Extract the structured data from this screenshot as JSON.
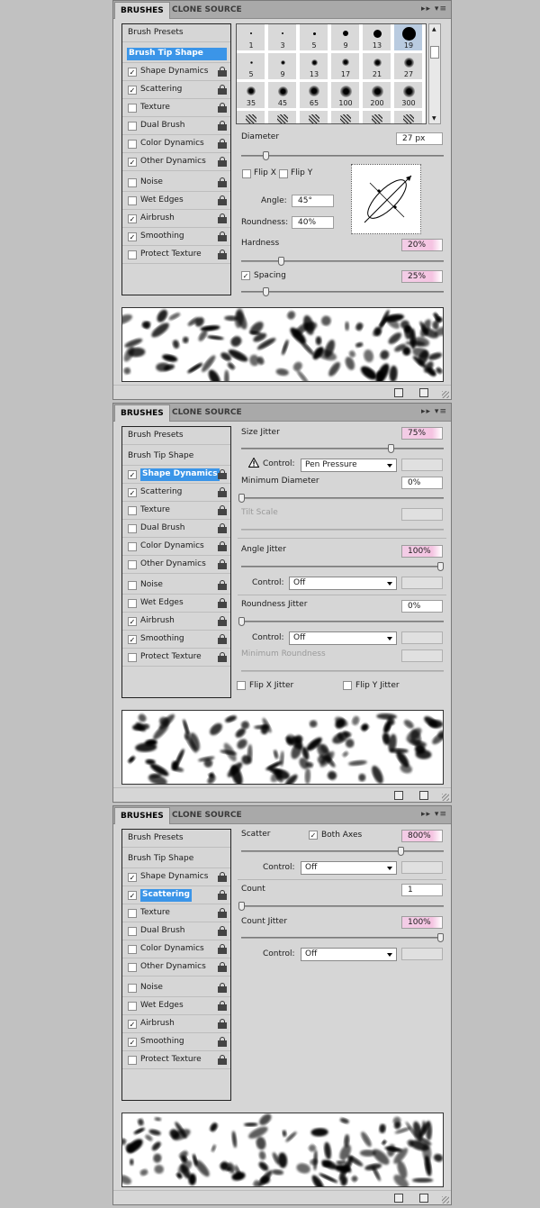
{
  "tabs": {
    "brushes": "BRUSHES",
    "clone_source": "CLONE SOURCE",
    "menu_glyph": "▸▸ ▾≡"
  },
  "list": {
    "brush_presets": "Brush Presets",
    "brush_tip_shape": "Brush Tip Shape",
    "shape_dynamics": "Shape Dynamics",
    "scattering": "Scattering",
    "texture": "Texture",
    "dual_brush": "Dual Brush",
    "color_dynamics": "Color Dynamics",
    "other_dynamics": "Other Dynamics",
    "noise": "Noise",
    "wet_edges": "Wet Edges",
    "airbrush": "Airbrush",
    "smoothing": "Smoothing",
    "protect_texture": "Protect Texture",
    "check": "✓"
  },
  "tip": {
    "sizes": [
      "1",
      "3",
      "5",
      "9",
      "13",
      "19",
      "5",
      "9",
      "13",
      "17",
      "21",
      "27",
      "35",
      "45",
      "65",
      "100",
      "200",
      "300"
    ],
    "diameter_label": "Diameter",
    "diameter_value": "27 px",
    "flip_x": "Flip X",
    "flip_y": "Flip Y",
    "angle_label": "Angle:",
    "angle_value": "45°",
    "roundness_label": "Roundness:",
    "roundness_value": "40%",
    "hardness_label": "Hardness",
    "hardness_value": "20%",
    "spacing_label": "Spacing",
    "spacing_value": "25%",
    "diameter_level": 0.12,
    "hardness_level": 0.2,
    "spacing_level": 0.12
  },
  "shape": {
    "size_jitter_label": "Size Jitter",
    "size_jitter_value": "75%",
    "control_label": "Control:",
    "control1": "Pen Pressure",
    "min_diameter_label": "Minimum Diameter",
    "min_diameter_value": "0%",
    "tilt_scale_label": "Tilt Scale",
    "angle_jitter_label": "Angle Jitter",
    "angle_jitter_value": "100%",
    "control2": "Off",
    "roundness_jitter_label": "Roundness Jitter",
    "roundness_jitter_value": "0%",
    "control3": "Off",
    "min_roundness_label": "Minimum Roundness",
    "flip_x_jitter": "Flip X Jitter",
    "flip_y_jitter": "Flip Y Jitter",
    "size_jitter_level": 0.75,
    "angle_jitter_level": 1.0
  },
  "scatter": {
    "scatter_label": "Scatter",
    "both_axes": "Both Axes",
    "scatter_value": "800%",
    "control_label": "Control:",
    "control1": "Off",
    "count_label": "Count",
    "count_value": "1",
    "count_jitter_label": "Count Jitter",
    "count_jitter_value": "100%",
    "control2": "Off",
    "scatter_level": 0.8,
    "count_level": 0.0,
    "count_jitter_level": 1.0
  },
  "colors": {
    "selection": "#3b95e8",
    "pink_field": "#f3cde6"
  }
}
